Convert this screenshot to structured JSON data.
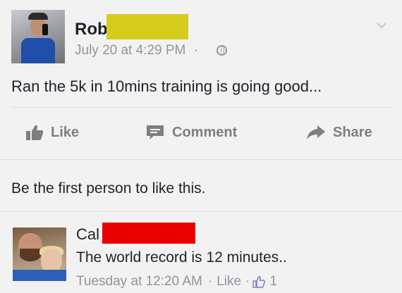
{
  "post": {
    "author": "Rob",
    "timestamp": "July 20 at 4:29 PM",
    "meta_separator": "·",
    "text": "Ran the 5k in 10mins training is going good..."
  },
  "actions": {
    "like": "Like",
    "comment": "Comment",
    "share": "Share"
  },
  "likes_line": "Be the first person to like this.",
  "comment": {
    "author": "Cal",
    "text": "The world record is 12 minutes..",
    "timestamp": "Tuesday at 12:20 AM",
    "separator": "·",
    "like_label": "Like",
    "like_count": "1"
  },
  "colors": {
    "redaction_yellow": "#d6cc1e",
    "redaction_red": "#e60000",
    "meta_gray": "#90949c",
    "action_gray": "#7f7f7f"
  },
  "icons": {
    "privacy": "globe-icon",
    "menu": "chevron-down-icon",
    "like": "thumbs-up-icon",
    "comment": "speech-bubble-icon",
    "share": "share-arrow-icon",
    "comment_like": "thumbs-up-outline-icon"
  }
}
